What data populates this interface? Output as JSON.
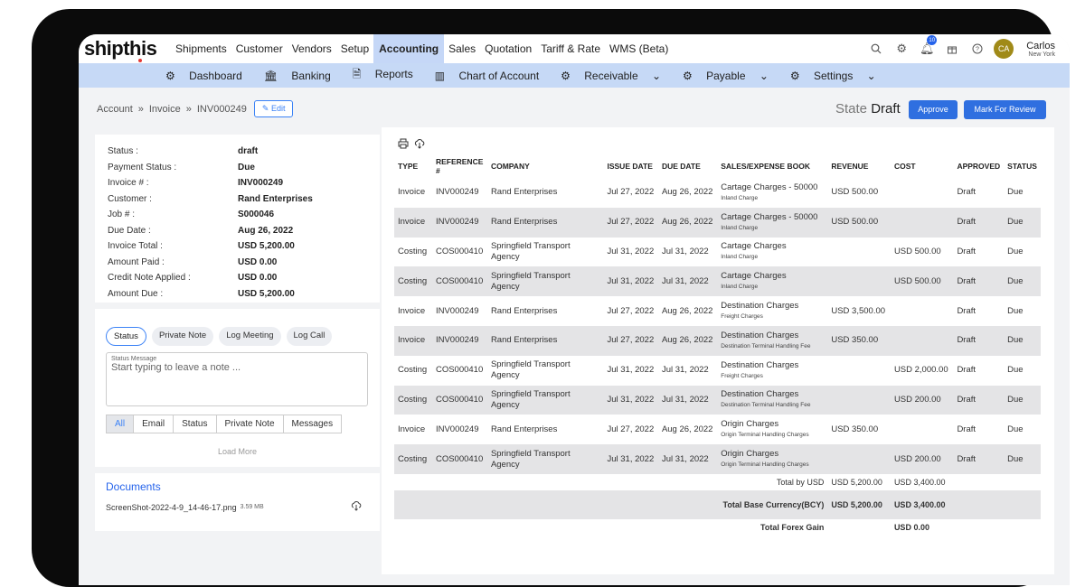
{
  "app": {
    "logo": "shipthis"
  },
  "topnav": {
    "items": [
      "Shipments",
      "Customer",
      "Vendors",
      "Setup",
      "Accounting",
      "Sales",
      "Quotation",
      "Tariff & Rate",
      "WMS (Beta)"
    ],
    "active": "Accounting",
    "notifications": "10",
    "user": {
      "initials": "CA",
      "name": "Carlos",
      "location": "New York"
    }
  },
  "subnav": {
    "items": [
      "Dashboard",
      "Banking",
      "Reports",
      "Chart of Account",
      "Receivable",
      "Payable",
      "Settings"
    ]
  },
  "breadcrumb": {
    "root": "Account",
    "section": "Invoice",
    "current": "INV000249",
    "edit": "Edit"
  },
  "state": {
    "label": "State",
    "value": "Draft"
  },
  "actions": {
    "approve": "Approve",
    "review": "Mark For Review"
  },
  "info": [
    {
      "k": "Status :",
      "v": "draft"
    },
    {
      "k": "Payment Status :",
      "v": "Due"
    },
    {
      "k": "Invoice # :",
      "v": "INV000249"
    },
    {
      "k": "Customer :",
      "v": "Rand Enterprises"
    },
    {
      "k": "Job # :",
      "v": "S000046"
    },
    {
      "k": "Due Date :",
      "v": "Aug 26, 2022"
    },
    {
      "k": "Invoice Total :",
      "v": "USD 5,200.00"
    },
    {
      "k": "Amount Paid :",
      "v": "USD 0.00"
    },
    {
      "k": "Credit Note Applied :",
      "v": "USD 0.00"
    },
    {
      "k": "Amount Due :",
      "v": "USD 5,200.00"
    }
  ],
  "notes": {
    "pills": [
      "Status",
      "Private Note",
      "Log Meeting",
      "Log Call"
    ],
    "message_label": "Status Message",
    "placeholder": "Start typing to leave a note ...",
    "tabs": [
      "All",
      "Email",
      "Status",
      "Private Note",
      "Messages"
    ],
    "load_more": "Load More"
  },
  "documents": {
    "title": "Documents",
    "file": "ScreenShot-2022-4-9_14-46-17.png",
    "size": "3.59 MB"
  },
  "table": {
    "headers": [
      "TYPE",
      "REFERENCE #",
      "COMPANY",
      "ISSUE DATE",
      "DUE DATE",
      "SALES/EXPENSE BOOK",
      "REVENUE",
      "COST",
      "APPROVED",
      "STATUS"
    ],
    "rows": [
      {
        "type": "Invoice",
        "ref": "INV000249",
        "company": "Rand Enterprises",
        "issue": "Jul 27, 2022",
        "due": "Aug 26, 2022",
        "book": "Cartage Charges - 50000",
        "book_sub": "Inland Charge",
        "revenue": "USD 500.00",
        "cost": "",
        "approved": "Draft",
        "status": "Due"
      },
      {
        "type": "Invoice",
        "ref": "INV000249",
        "company": "Rand Enterprises",
        "issue": "Jul 27, 2022",
        "due": "Aug 26, 2022",
        "book": "Cartage Charges - 50000",
        "book_sub": "Inland Charge",
        "revenue": "USD 500.00",
        "cost": "",
        "approved": "Draft",
        "status": "Due"
      },
      {
        "type": "Costing",
        "ref": "COS000410",
        "company": "Springfield Transport Agency",
        "issue": "Jul 31, 2022",
        "due": "Jul 31, 2022",
        "book": "Cartage Charges",
        "book_sub": "Inland Charge",
        "revenue": "",
        "cost": "USD 500.00",
        "approved": "Draft",
        "status": "Due"
      },
      {
        "type": "Costing",
        "ref": "COS000410",
        "company": "Springfield Transport Agency",
        "issue": "Jul 31, 2022",
        "due": "Jul 31, 2022",
        "book": "Cartage Charges",
        "book_sub": "Inland Charge",
        "revenue": "",
        "cost": "USD 500.00",
        "approved": "Draft",
        "status": "Due"
      },
      {
        "type": "Invoice",
        "ref": "INV000249",
        "company": "Rand Enterprises",
        "issue": "Jul 27, 2022",
        "due": "Aug 26, 2022",
        "book": "Destination Charges",
        "book_sub": "Freight Charges",
        "revenue": "USD 3,500.00",
        "cost": "",
        "approved": "Draft",
        "status": "Due"
      },
      {
        "type": "Invoice",
        "ref": "INV000249",
        "company": "Rand Enterprises",
        "issue": "Jul 27, 2022",
        "due": "Aug 26, 2022",
        "book": "Destination Charges",
        "book_sub": "Destination Terminal Handling Fee",
        "revenue": "USD 350.00",
        "cost": "",
        "approved": "Draft",
        "status": "Due"
      },
      {
        "type": "Costing",
        "ref": "COS000410",
        "company": "Springfield Transport Agency",
        "issue": "Jul 31, 2022",
        "due": "Jul 31, 2022",
        "book": "Destination Charges",
        "book_sub": "Freight Charges",
        "revenue": "",
        "cost": "USD 2,000.00",
        "approved": "Draft",
        "status": "Due"
      },
      {
        "type": "Costing",
        "ref": "COS000410",
        "company": "Springfield Transport Agency",
        "issue": "Jul 31, 2022",
        "due": "Jul 31, 2022",
        "book": "Destination Charges",
        "book_sub": "Destination Terminal Handling Fee",
        "revenue": "",
        "cost": "USD 200.00",
        "approved": "Draft",
        "status": "Due"
      },
      {
        "type": "Invoice",
        "ref": "INV000249",
        "company": "Rand Enterprises",
        "issue": "Jul 27, 2022",
        "due": "Aug 26, 2022",
        "book": "Origin Charges",
        "book_sub": "Origin Terminal Handling Charges",
        "revenue": "USD 350.00",
        "cost": "",
        "approved": "Draft",
        "status": "Due"
      },
      {
        "type": "Costing",
        "ref": "COS000410",
        "company": "Springfield Transport Agency",
        "issue": "Jul 31, 2022",
        "due": "Jul 31, 2022",
        "book": "Origin Charges",
        "book_sub": "Origin Terminal Handling Charges",
        "revenue": "",
        "cost": "USD 200.00",
        "approved": "Draft",
        "status": "Due"
      }
    ],
    "totals": {
      "by_usd_label": "Total by USD",
      "by_usd_revenue": "USD 5,200.00",
      "by_usd_cost": "USD 3,400.00",
      "bcy_label": "Total Base Currency(BCY)",
      "bcy_revenue": "USD 5,200.00",
      "bcy_cost": "USD 3,400.00",
      "forex_label": "Total Forex Gain",
      "forex_value": "USD 0.00"
    }
  }
}
